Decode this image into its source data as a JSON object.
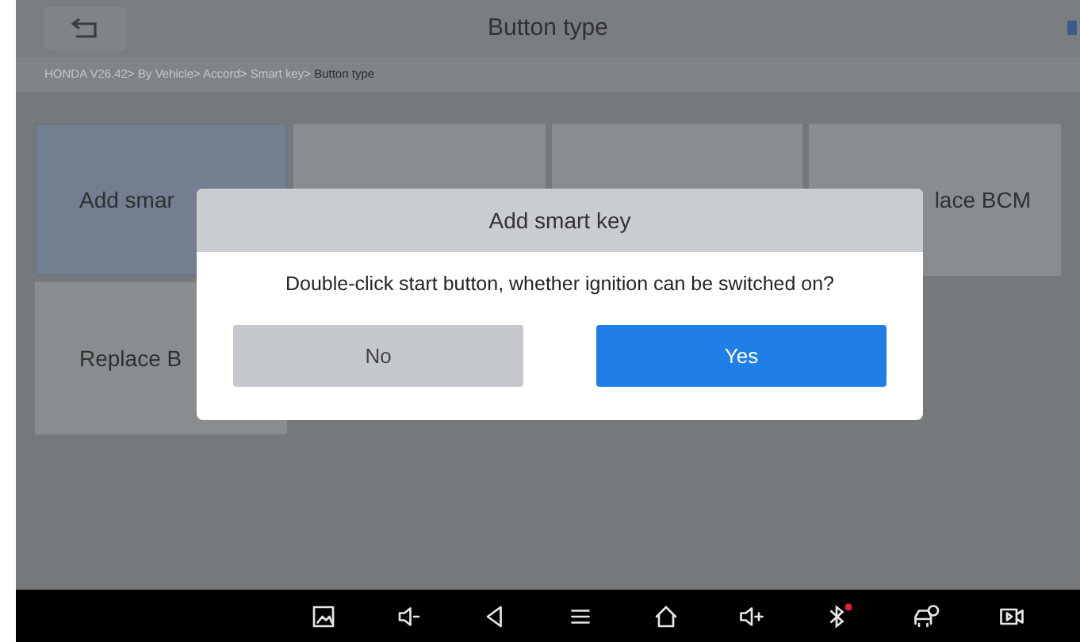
{
  "header": {
    "title": "Button type"
  },
  "breadcrumb": "HONDA V26.42> By Vehicle> Accord> Smart key> **Button type**",
  "tiles": [
    {
      "label": "Add smar",
      "selected": true
    },
    {
      "selected": false
    },
    {
      "selected": false
    },
    {
      "label": "lace BCM",
      "selected": false
    },
    {
      "label": "Replace B",
      "selected": false
    }
  ],
  "dialog": {
    "title": "Add smart key",
    "message": "Double-click start button, whether ignition can be switched on?",
    "buttons": [
      {
        "label": "No",
        "kind": "secondary"
      },
      {
        "label": "Yes",
        "kind": "primary"
      }
    ]
  },
  "nav_bar": {
    "bluetooth_alert": true
  }
}
